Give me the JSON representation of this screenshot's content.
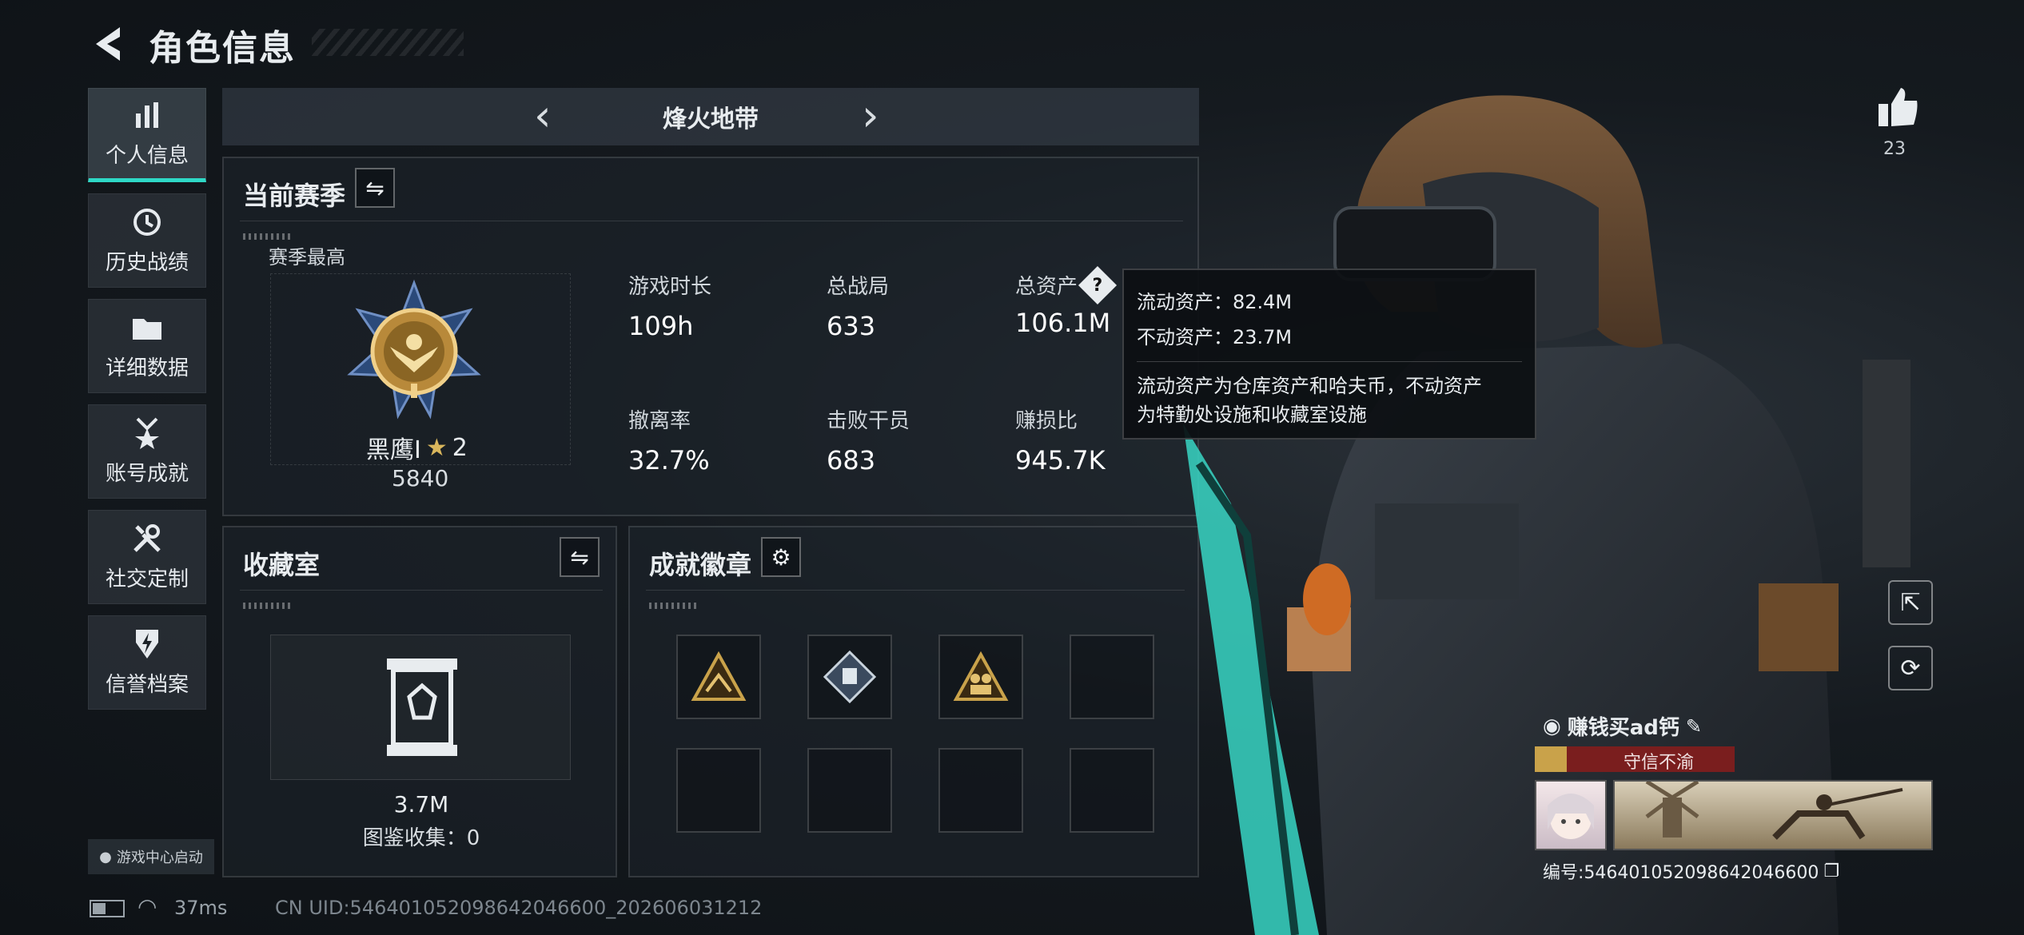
{
  "header": {
    "title": "角色信息"
  },
  "sidebar": {
    "items": [
      {
        "label": "个人信息",
        "icon": "bar-chart-icon"
      },
      {
        "label": "历史战绩",
        "icon": "history-clock-icon"
      },
      {
        "label": "详细数据",
        "icon": "folder-icon"
      },
      {
        "label": "账号成就",
        "icon": "medal-icon"
      },
      {
        "label": "社交定制",
        "icon": "wrench-screwdriver-icon"
      },
      {
        "label": "信誉档案",
        "icon": "shield-lightning-icon"
      }
    ],
    "launch_label": "游戏中心启动"
  },
  "mode_bar": {
    "label": "烽火地带"
  },
  "season": {
    "title": "当前赛季",
    "best_label": "赛季最高",
    "rank_name": "黑鹰I",
    "rank_stars": "2",
    "rank_score": "5840",
    "stats": [
      {
        "label": "游戏时长",
        "value": "109h"
      },
      {
        "label": "总战局",
        "value": "633"
      },
      {
        "label": "总资产",
        "value": "106.1M"
      },
      {
        "label": "撤离率",
        "value": "32.7%"
      },
      {
        "label": "击败干员",
        "value": "683"
      },
      {
        "label": "赚损比",
        "value": "945.7K"
      }
    ]
  },
  "tooltip": {
    "liquid": "流动资产：82.4M",
    "fixed": "不动资产：23.7M",
    "desc_line1": "流动资产为仓库资产和哈夫币，不动资产",
    "desc_line2": "为特勤处设施和收藏室设施"
  },
  "collection": {
    "title": "收藏室",
    "value": "3.7M",
    "catalog": "图鉴收集：0"
  },
  "badges": {
    "title": "成就徽章"
  },
  "player": {
    "likes": "23",
    "name": "赚钱买ad钙",
    "reputation": "守信不渝",
    "id_text": "编号:546401052098642046600"
  },
  "status_bar": {
    "ping": "37ms",
    "uid": "CN UID:546401052098642046600_202606031212"
  },
  "colors": {
    "accent": "#2ed8c6",
    "badge_gold": "#c9a24a",
    "reputation_red": "#7a1e1e"
  }
}
